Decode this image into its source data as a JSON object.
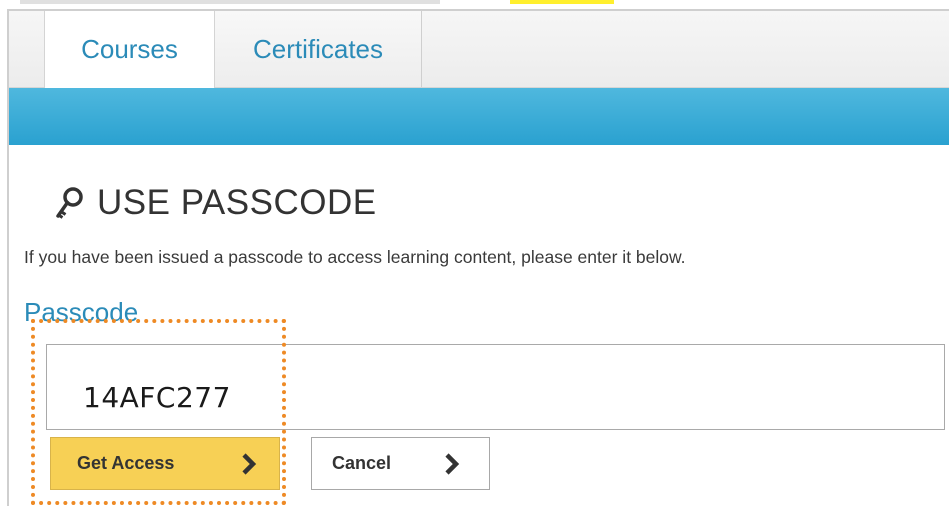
{
  "tabs": [
    {
      "label": "Courses",
      "active": true
    },
    {
      "label": "Certificates",
      "active": false
    }
  ],
  "heading": {
    "icon": "key-icon",
    "title": "USE PASSCODE"
  },
  "description": "If you have been issued a passcode to access learning content, please enter it below.",
  "passcode": {
    "label": "Passcode",
    "value": "14AFC277"
  },
  "buttons": {
    "get_access": "Get Access",
    "cancel": "Cancel"
  },
  "colors": {
    "accent_blue": "#2b8bb8",
    "band_blue": "#3aaed8",
    "primary_button": "#f7d055",
    "highlight_border": "#ee8a25",
    "top_highlight": "#ffef2e"
  }
}
